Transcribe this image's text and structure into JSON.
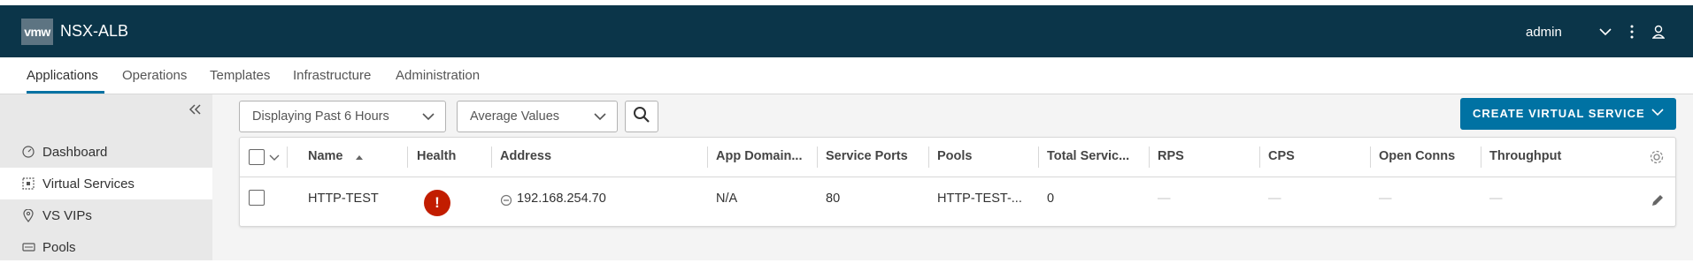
{
  "header": {
    "logo": "vmw",
    "app_name": "NSX-ALB",
    "user": "admin"
  },
  "nav": {
    "tabs": [
      {
        "label": "Applications"
      },
      {
        "label": "Operations"
      },
      {
        "label": "Templates"
      },
      {
        "label": "Infrastructure"
      },
      {
        "label": "Administration"
      }
    ],
    "active_tab": "Applications"
  },
  "sidebar": {
    "items": [
      {
        "label": "Dashboard",
        "icon": "dashboard-icon"
      },
      {
        "label": "Virtual Services",
        "icon": "virtual-services-icon",
        "active": true
      },
      {
        "label": "VS VIPs",
        "icon": "location-pin-icon"
      },
      {
        "label": "Pools",
        "icon": "pools-icon"
      }
    ]
  },
  "toolbar": {
    "time_range": "Displaying Past 6 Hours",
    "metric_mode": "Average Values",
    "create_label": "CREATE VIRTUAL SERVICE"
  },
  "table": {
    "columns": [
      "Name",
      "Health",
      "Address",
      "App Domain...",
      "Service Ports",
      "Pools",
      "Total Servic...",
      "RPS",
      "CPS",
      "Open Conns",
      "Throughput"
    ],
    "sorted_column": "Name",
    "rows": [
      {
        "name": "HTTP-TEST",
        "health": "!",
        "health_status": "critical",
        "address": "192.168.254.70",
        "app_domain": "N/A",
        "service_ports": "80",
        "pools": "HTTP-TEST-...",
        "total_services": "0",
        "rps": "—",
        "cps": "—",
        "open_conns": "—",
        "throughput": "—"
      }
    ]
  },
  "colors": {
    "header_bg": "#0b3549",
    "accent": "#0072a3",
    "health_critical": "#c21d00"
  }
}
